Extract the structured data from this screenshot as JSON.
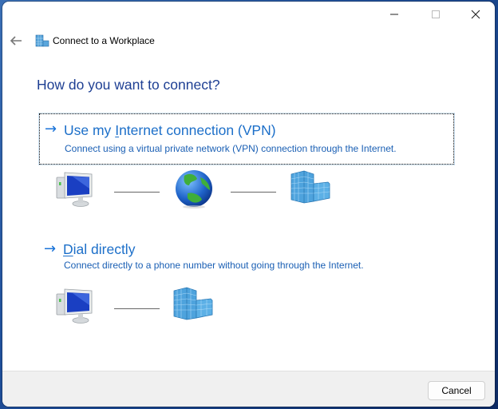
{
  "window": {
    "title": "Connect to a Workplace",
    "app_icon": "workplace-building-icon",
    "caption_buttons": {
      "minimize_icon": "minimize-icon",
      "maximize_icon": "maximize-icon",
      "close_icon": "close-icon"
    },
    "back_icon": "back-arrow-icon"
  },
  "page": {
    "heading": "How do you want to connect?"
  },
  "options": [
    {
      "title_pre": "Use my ",
      "title_access_key": "I",
      "title_post": "nternet connection (VPN)",
      "description": "Connect using a virtual private network (VPN) connection through the Internet.",
      "arrow_icon": "arrow-right-icon",
      "diagram": [
        "computer-icon",
        "globe-icon",
        "workplace-building-icon"
      ]
    },
    {
      "title_pre": "",
      "title_access_key": "D",
      "title_post": "ial directly",
      "description": "Connect directly to a phone number without going through the Internet.",
      "arrow_icon": "arrow-right-icon",
      "diagram": [
        "computer-icon",
        "workplace-building-icon"
      ]
    }
  ],
  "footer": {
    "cancel_label": "Cancel"
  },
  "colors": {
    "heading": "#1e3f93",
    "link": "#1c6fc9",
    "footer_bg": "#f0f0f0"
  }
}
